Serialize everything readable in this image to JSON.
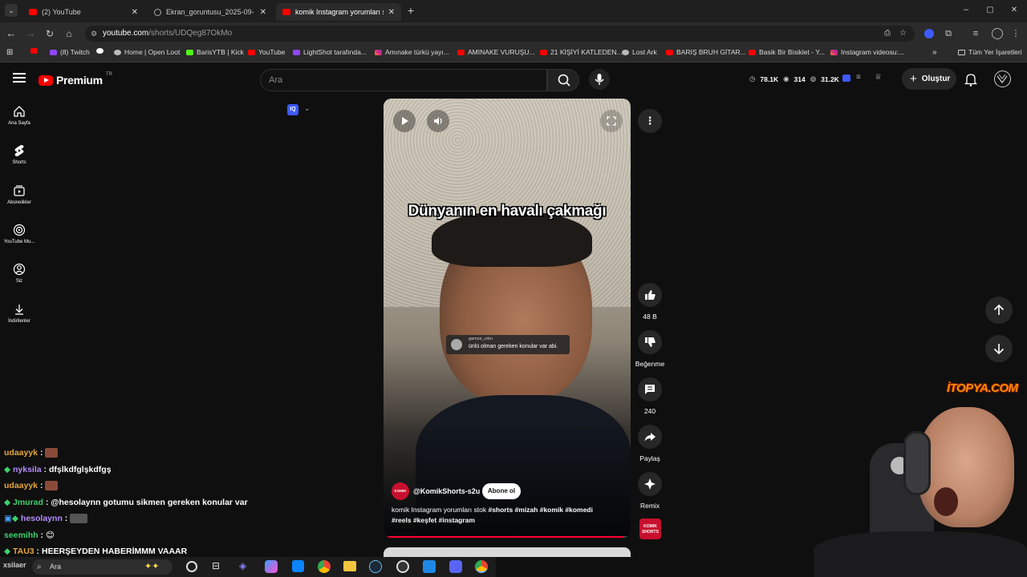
{
  "browser": {
    "tabs": [
      {
        "title": "(2) YouTube"
      },
      {
        "title": "Ekran_goruntusu_2025-09-05_..."
      },
      {
        "title": "komik Instagram yorumları stok"
      }
    ],
    "new_tab": "+",
    "window_controls": {
      "minimize": "–",
      "maximize": "▢",
      "close": "✕"
    },
    "url_host": "youtube.com",
    "url_path": "/shorts/UDQeg87OkMo",
    "bookmarks": [
      {
        "label": "(8) Twitch",
        "icon": "purple"
      },
      {
        "label": "",
        "icon": "google"
      },
      {
        "label": "Home | Open Loot",
        "icon": "gray"
      },
      {
        "label": "BarisYTB | Kick",
        "icon": "green"
      },
      {
        "label": "YouTube",
        "icon": "red"
      },
      {
        "label": "LightShot tarafında...",
        "icon": "purple"
      },
      {
        "label": "Amınake türkü yayı...",
        "icon": "insta"
      },
      {
        "label": "AMINAKE VURUŞU...",
        "icon": "red"
      },
      {
        "label": "21 KİŞİYİ KATLEDEN...",
        "icon": "red"
      },
      {
        "label": "Lost Ark",
        "icon": "gray"
      },
      {
        "label": "BARIŞ BRUH GİTAR...",
        "icon": "red"
      },
      {
        "label": "Basik Bir Bisiklet - Y...",
        "icon": "red"
      },
      {
        "label": "Instagram videosu:...",
        "icon": "insta"
      }
    ],
    "all_bookmarks": "Tüm Yer İşaretleri"
  },
  "yt": {
    "logo": "Premium",
    "region": "TR",
    "search_placeholder": "Ara",
    "stats": {
      "views": "78.1K",
      "viewers": "314",
      "followers": "31.2K"
    },
    "create_label": "Oluştur",
    "sidebar": [
      {
        "label": "Ana Sayfa"
      },
      {
        "label": "Shorts"
      },
      {
        "label": "Abonelikler"
      },
      {
        "label": "YouTube Mu..."
      },
      {
        "label": "Siz"
      },
      {
        "label": "İndirilenler"
      }
    ]
  },
  "video": {
    "caption": "Dünyanın en havalı çakmağı",
    "comment_user": "gamze_crkn",
    "comment_text": "ünlü olman gereken konular var abi.",
    "channel": "@KomikShorts-s2u",
    "channel_avatar_text": "KOMIK SHORTS",
    "subscribe": "Abone ol",
    "description_line1": "komik Instagram yorumları stok",
    "description_tags1": "#shorts #mizah #komik #komedi",
    "description_tags2": "#reels #keşfet #instagram",
    "progress": 0.97
  },
  "actions": {
    "likes": "48 B",
    "dislike": "Beğenme",
    "comments": "240",
    "share": "Paylaş",
    "remix": "Remix",
    "channel_badge": "KOMIK SHORTS"
  },
  "overlay": {
    "watermark": "İTOPYA.COM"
  },
  "chat": [
    {
      "user": "udaayyk",
      "msg": "",
      "color": "#e6a53a",
      "emote": true,
      "badge": false
    },
    {
      "user": "nyksila",
      "msg": "dfşlkdfglşkdfgş",
      "color": "#b48cff",
      "emote": false,
      "badge": true
    },
    {
      "user": "udaayyk",
      "msg": "",
      "color": "#e6a53a",
      "emote": true,
      "badge": false
    },
    {
      "user": "Jmurad",
      "msg": "@hesolaynn gotumu sikmen gereken konular var",
      "color": "#3ecf6e",
      "emote": false,
      "badge": true
    },
    {
      "user": "hesolaynn",
      "msg": "",
      "color": "#b48cff",
      "emote": true,
      "badge": true
    },
    {
      "user": "seemihh",
      "msg": "😊",
      "color": "#3ecf6e",
      "emote": false,
      "badge": false
    },
    {
      "user": "TAU3",
      "msg": "HEERŞEYDEN HABERİMMM VAAAR",
      "color": "#e6a53a",
      "emote": false,
      "badge": true
    }
  ],
  "taskbar": {
    "search": "Ara",
    "user": "xsilaer"
  }
}
